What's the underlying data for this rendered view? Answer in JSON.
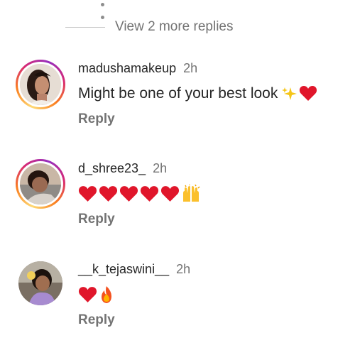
{
  "thread": {
    "view_more_replies": "View 2 more replies"
  },
  "comments": [
    {
      "username": "madushamakeup",
      "time": "2h",
      "text": "Might be one of your best look",
      "emojis": [
        "sparkles",
        "red-heart"
      ],
      "reply_label": "Reply",
      "has_story_ring": true
    },
    {
      "username": "d_shree23_",
      "time": "2h",
      "text": "",
      "emojis": [
        "red-heart",
        "red-heart",
        "red-heart",
        "red-heart",
        "red-heart",
        "raising-hands"
      ],
      "reply_label": "Reply",
      "has_story_ring": true
    },
    {
      "username": "__k_tejaswini__",
      "time": "2h",
      "text": "",
      "emojis": [
        "red-heart",
        "fire"
      ],
      "reply_label": "Reply",
      "has_story_ring": false
    }
  ],
  "colors": {
    "primary_text": "#262626",
    "secondary_text": "#737373",
    "heart": "#e0162b",
    "divider": "#c7c7c7"
  }
}
